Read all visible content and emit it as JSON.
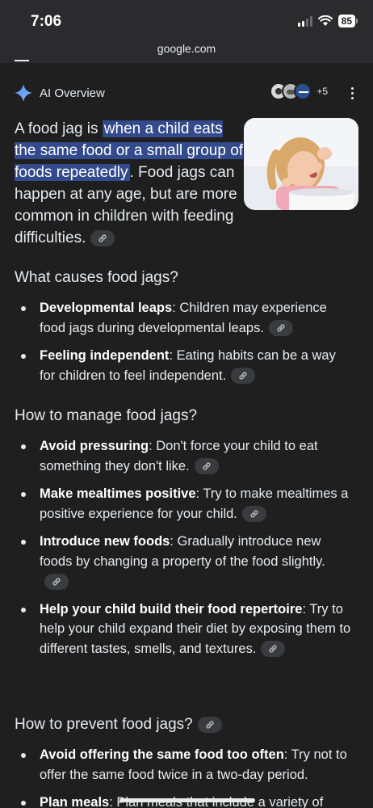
{
  "status": {
    "time": "7:06",
    "battery": "85"
  },
  "browser": {
    "url": "google.com"
  },
  "ai_overview": {
    "label": "AI Overview",
    "sources_more": "+5",
    "intro_before": "A food jag is ",
    "intro_highlight": "when a child eats the same food or a small group of foods repeatedly",
    "intro_after": ". Food jags can happen at any age, but are more common in children with feeding difficulties."
  },
  "sections": [
    {
      "title": "What causes food jags?",
      "items": [
        {
          "term": "Developmental leaps",
          "text": ": Children may experience food jags during developmental leaps."
        },
        {
          "term": "Feeling independent",
          "text": ": Eating habits can be a way for children to feel independent."
        }
      ]
    },
    {
      "title": "How to manage food jags?",
      "items": [
        {
          "term": "Avoid pressuring",
          "text": ": Don't force your child to eat something they don't like."
        },
        {
          "term": "Make mealtimes positive",
          "text": ": Try to make mealtimes a positive experience for your child."
        },
        {
          "term": "Introduce new foods",
          "text": ": Gradually introduce new foods by changing a property of the food slightly."
        },
        {
          "term": "Help your child build their food repertoire",
          "text": ": Try to help your child expand their diet by exposing them to different tastes, smells, and textures."
        }
      ]
    },
    {
      "title": "How to prevent food jags?",
      "items": [
        {
          "term": "Avoid offering the same food too often",
          "text": ": Try not to offer the same food twice in a two-day period."
        },
        {
          "term": "Plan meals",
          "text": ": Plan meals that include a variety of"
        }
      ]
    }
  ]
}
